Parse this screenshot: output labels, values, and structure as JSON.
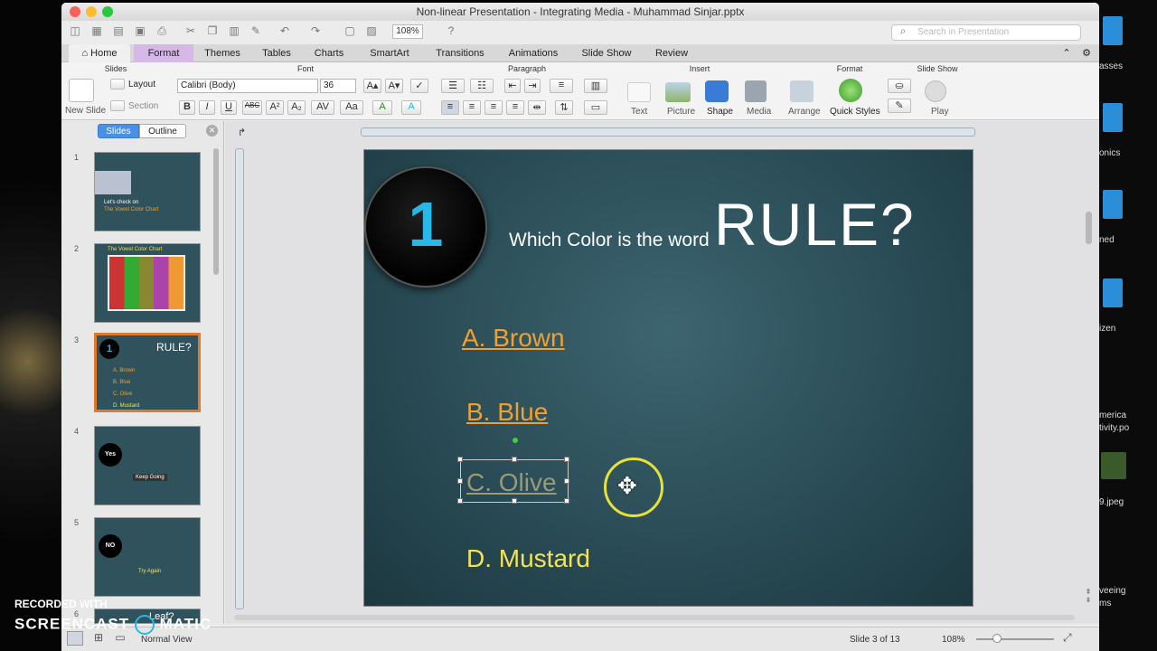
{
  "window": {
    "title": "Non-linear Presentation - Integrating Media - Muhammad Sinjar.pptx",
    "zoom": "108%",
    "search_placeholder": "Search in Presentation"
  },
  "tabs": [
    "Home",
    "Format",
    "Themes",
    "Tables",
    "Charts",
    "SmartArt",
    "Transitions",
    "Animations",
    "Slide Show",
    "Review"
  ],
  "ribbon": {
    "groups": {
      "slides": "Slides",
      "font": "Font",
      "paragraph": "Paragraph",
      "insert": "Insert",
      "format": "Format",
      "slideshow": "Slide Show"
    },
    "new_slide": "New Slide",
    "layout": "Layout",
    "section": "Section",
    "font_name": "Calibri (Body)",
    "font_size": "36",
    "insert_items": [
      "Text",
      "Picture",
      "Shape",
      "Media"
    ],
    "format_items": [
      "Arrange",
      "Quick Styles"
    ],
    "play": "Play"
  },
  "panel": {
    "slides_tab": "Slides",
    "outline_tab": "Outline",
    "thumbs": [
      {
        "num": "1",
        "text1": "Let's check on",
        "text2": "The Vowel Color Chart"
      },
      {
        "num": "2",
        "text1": "The Vowel Color Chart"
      },
      {
        "num": "3",
        "text1": "1",
        "text2": "RULE?"
      },
      {
        "num": "4",
        "text1": "Yes",
        "text2": "Keep Going"
      },
      {
        "num": "5",
        "text1": "NO",
        "text2": "Try Again"
      },
      {
        "num": "6",
        "text1": "Leaf?"
      }
    ]
  },
  "slide": {
    "number": "1",
    "question_prefix": "Which Color is the word",
    "question_word": "RULE?",
    "answers": [
      "A. Brown",
      "B. Blue",
      "C. Olive",
      "D. Mustard"
    ]
  },
  "status": {
    "view": "Normal View",
    "slide_counter": "Slide 3 of 13",
    "zoom": "108%"
  },
  "watermark": {
    "line1": "RECORDED WITH",
    "line2": "SCREENCAST",
    "line3": "MATIC"
  },
  "desktop": {
    "labels": [
      "asses",
      "onics",
      "ned",
      "izen",
      "merica",
      "tivity.po",
      "9.jpeg",
      "veeing",
      "ms"
    ]
  },
  "colors": {
    "slide_bg": "#2f525c",
    "number_blue": "#29b6e8",
    "answer_orange": "#f0a030",
    "answer_yellow": "#f2e35a",
    "format_tab": "#d5b8e6",
    "selected_thumb": "#e07a28",
    "cursor_ring": "#e6e23a"
  }
}
